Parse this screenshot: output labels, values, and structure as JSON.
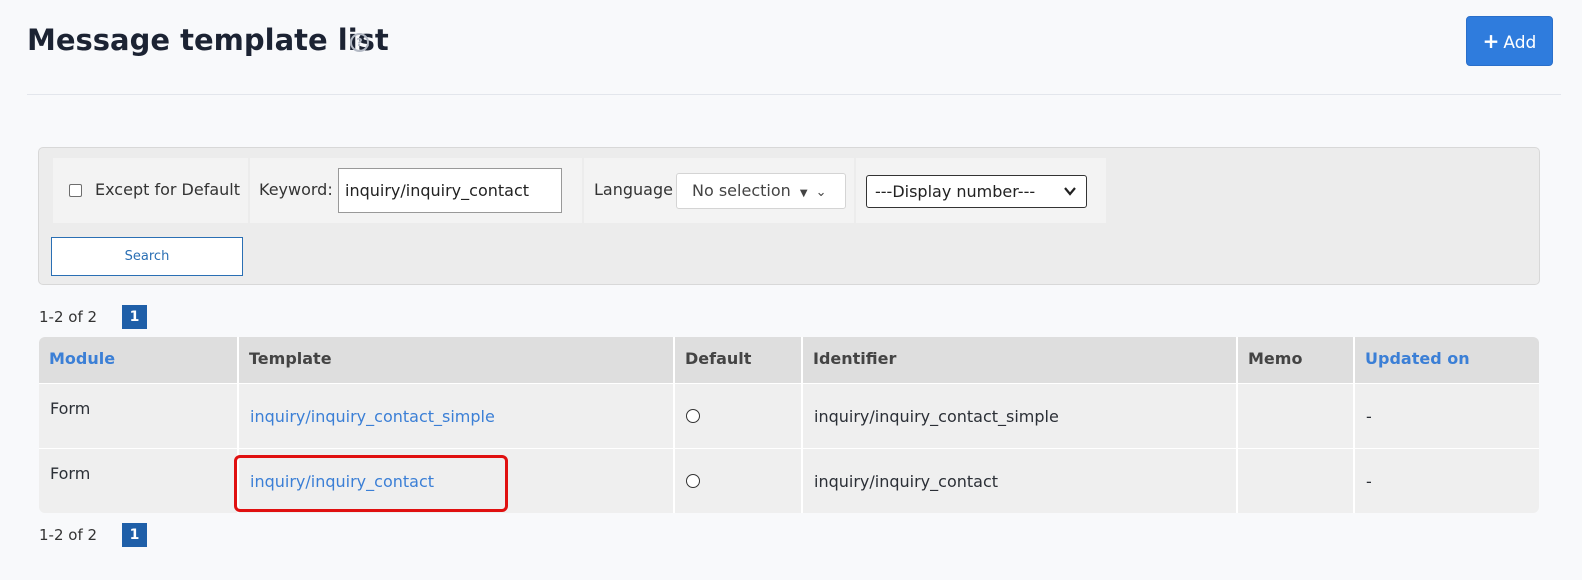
{
  "header": {
    "title": "Message template list",
    "help_glyph": "?",
    "add_label": "Add",
    "add_glyph": "+"
  },
  "filters": {
    "except_default_label": "Except for Default",
    "except_default_checked": false,
    "keyword_label": "Keyword:",
    "keyword_value": "inquiry/inquiry_contact",
    "language_label": "Language",
    "language_value": "No selection",
    "display_value": "---Display number---",
    "search_label": "Search"
  },
  "pagination": {
    "summary": "1-2 of 2",
    "current_page": "1"
  },
  "table": {
    "headers": {
      "module": "Module",
      "template": "Template",
      "default": "Default",
      "identifier": "Identifier",
      "memo": "Memo",
      "updated": "Updated on"
    },
    "rows": [
      {
        "module": "Form",
        "template": "inquiry/inquiry_contact_simple",
        "default": false,
        "identifier": "inquiry/inquiry_contact_simple",
        "memo": "",
        "updated": "-"
      },
      {
        "module": "Form",
        "template": "inquiry/inquiry_contact",
        "default": false,
        "identifier": "inquiry/inquiry_contact",
        "memo": "",
        "updated": "-"
      }
    ]
  },
  "icons": {
    "help": "help-circle-icon",
    "add": "plus-icon",
    "language_caret": "caret-down-icon",
    "chevron": "chevron-down-icon"
  },
  "colors": {
    "accent": "#2f7cdd",
    "link": "#3b7fd6",
    "page_badge": "#1f5fa8",
    "highlight": "#e01010"
  }
}
